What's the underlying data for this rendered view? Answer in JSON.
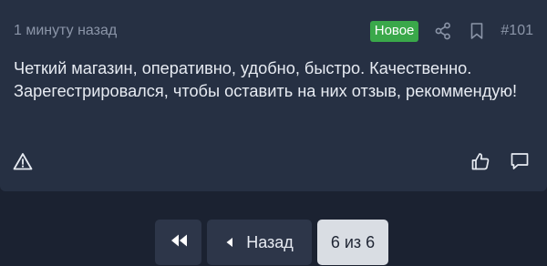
{
  "post": {
    "time": "1 минуту назад",
    "badge": "Новое",
    "number": "#101",
    "text": "Четкий магазин, оперативно, удобно, быстро. Качественно. Зарегестрировался, чтобы оставить на них отзыв, рекоммендую!"
  },
  "icons": {
    "share": "share-icon",
    "bookmark": "bookmark-icon",
    "warning": "warning-icon",
    "like": "thumbs-up-icon",
    "comment": "comment-icon",
    "first": "double-left-arrow-icon",
    "prev": "left-arrow-icon"
  },
  "pagination": {
    "prev_label": "Назад",
    "current_label": "6 из 6"
  },
  "colors": {
    "background": "#1b2231",
    "card": "#263043",
    "badge": "#3aa84a",
    "button": "#2d3649",
    "current_button": "#d9dde3"
  }
}
